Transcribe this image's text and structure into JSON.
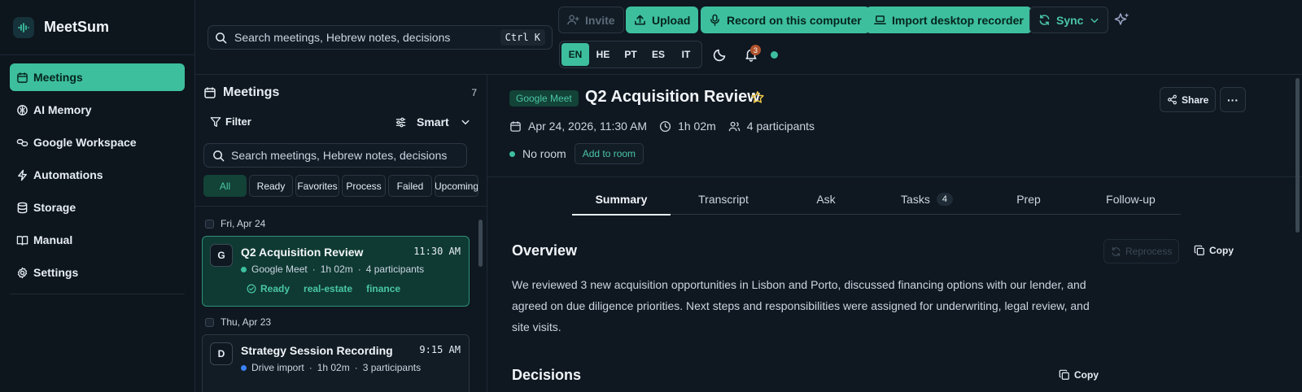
{
  "app": {
    "name": "MeetSum"
  },
  "sidebar": {
    "items": [
      {
        "label": "Meetings",
        "icon": "calendar-icon",
        "active": true
      },
      {
        "label": "AI Memory",
        "icon": "brain-icon"
      },
      {
        "label": "Google Workspace",
        "icon": "link-icon"
      },
      {
        "label": "Automations",
        "icon": "bolt-icon"
      },
      {
        "label": "Storage",
        "icon": "database-icon"
      },
      {
        "label": "Manual",
        "icon": "book-icon"
      },
      {
        "label": "Settings",
        "icon": "gear-icon"
      }
    ]
  },
  "topbar": {
    "search_placeholder": "Search meetings, Hebrew notes, decisions",
    "shortcut": "Ctrl K",
    "invite_label": "Invite",
    "upload_label": "Upload",
    "record_label": "Record on this computer",
    "import_label": "Import desktop recorder",
    "sync_label": "Sync",
    "languages": [
      "EN",
      "HE",
      "PT",
      "ES",
      "IT"
    ],
    "active_language": "EN",
    "notifications_count": "3",
    "status_color": "#3dbf9e"
  },
  "meetings_list": {
    "title": "Meetings",
    "count": "7",
    "filter_label": "Filter",
    "sort_label": "Smart",
    "search_placeholder": "Search meetings, Hebrew notes, decisions",
    "chips": [
      "All",
      "Ready",
      "Favorites",
      "Process",
      "Failed",
      "Upcoming"
    ],
    "groups": [
      {
        "day": "Fri, Apr 24",
        "meetings": [
          {
            "avatar": "G",
            "title": "Q2 Acquisition Review",
            "time": "11:30 AM",
            "source": "Google Meet",
            "duration": "1h 02m",
            "participants": "4 participants",
            "status": "Ready",
            "tags": [
              "real-estate",
              "finance"
            ],
            "selected": true
          }
        ]
      },
      {
        "day": "Thu, Apr 23",
        "meetings": [
          {
            "avatar": "D",
            "title": "Strategy Session Recording",
            "time": "9:15 AM",
            "source": "Drive import",
            "duration": "1h 02m",
            "participants": "3 participants"
          }
        ]
      }
    ]
  },
  "detail": {
    "source_badge": "Google Meet",
    "title": "Q2 Acquisition Review",
    "share_label": "Share",
    "date": "Apr 24, 2026, 11:30 AM",
    "duration": "1h 02m",
    "participants": "4 participants",
    "room": "No room",
    "add_room_label": "Add to room",
    "tabs": [
      {
        "label": "Summary",
        "active": true
      },
      {
        "label": "Transcript"
      },
      {
        "label": "Ask"
      },
      {
        "label": "Tasks",
        "badge": "4"
      },
      {
        "label": "Prep"
      },
      {
        "label": "Follow-up"
      }
    ],
    "overview": {
      "title": "Overview",
      "reprocess_label": "Reprocess",
      "copy_label": "Copy",
      "text": "We reviewed 3 new acquisition opportunities in Lisbon and Porto, discussed financing options with our lender, and agreed on due diligence priorities. Next steps and responsibilities were assigned for underwriting, legal review, and site visits."
    },
    "decisions": {
      "title": "Decisions",
      "copy_label": "Copy"
    }
  }
}
